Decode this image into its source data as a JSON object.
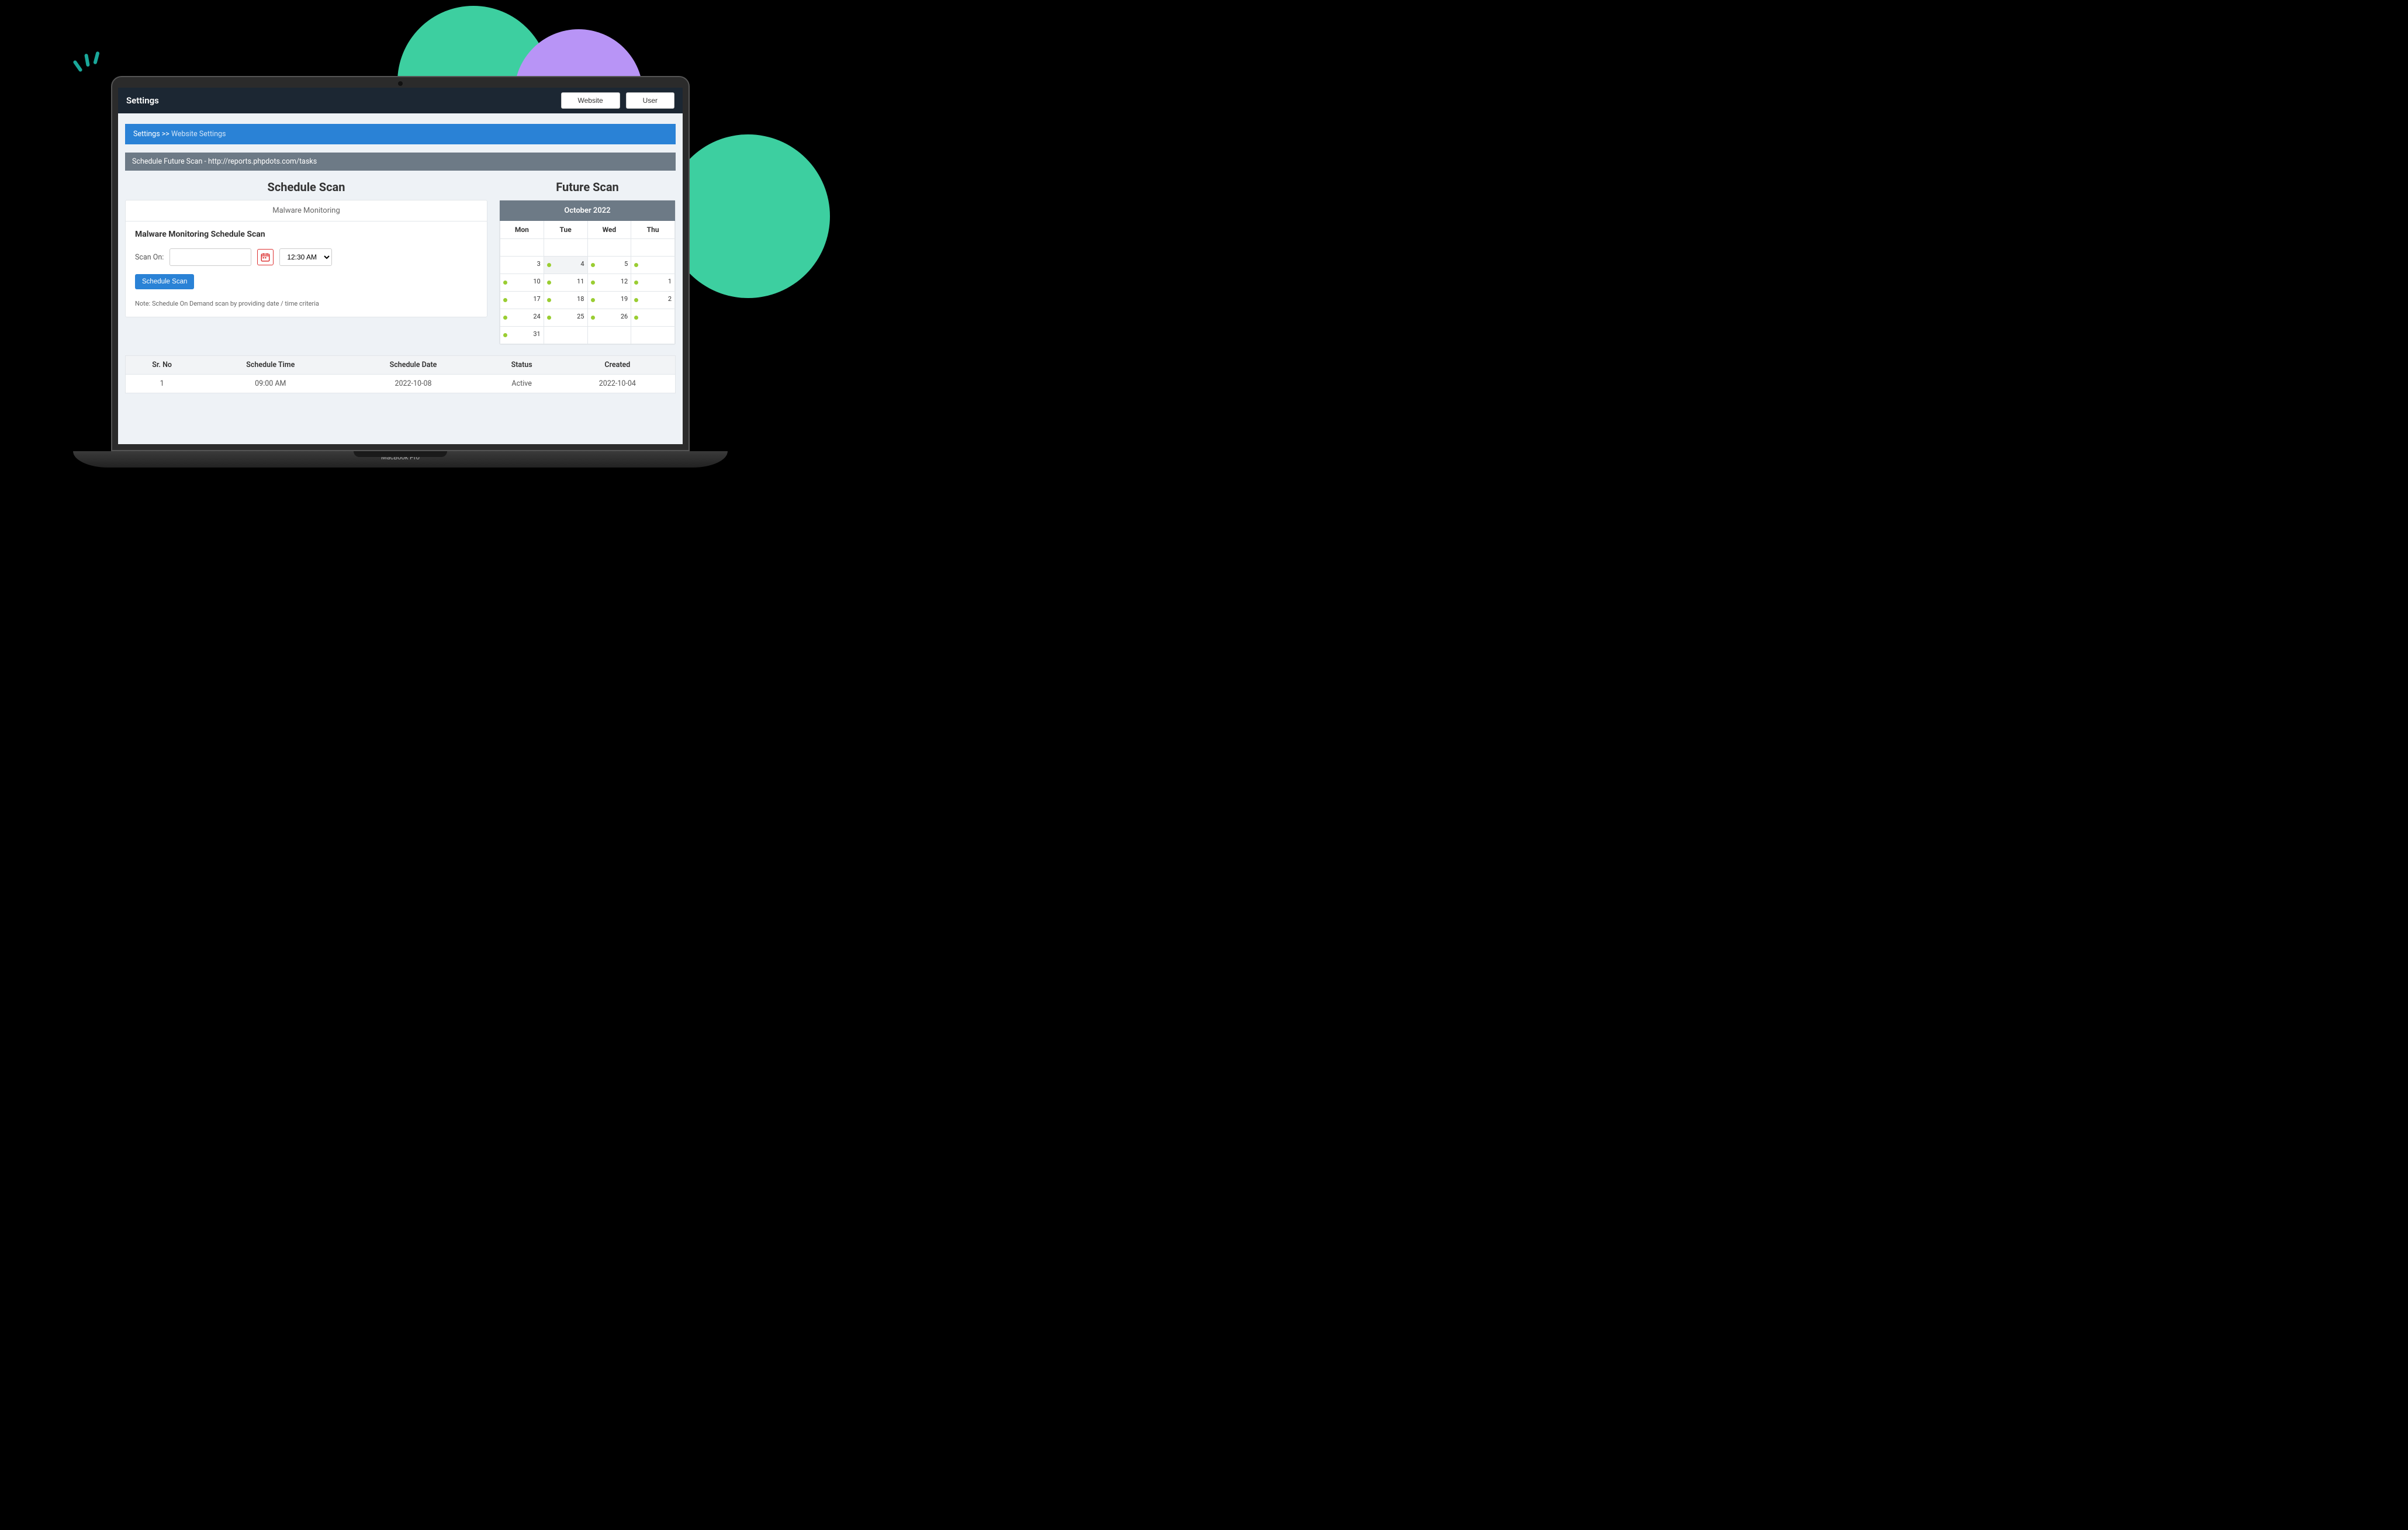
{
  "header": {
    "title": "Settings",
    "buttons": {
      "website": "Website",
      "user": "User"
    }
  },
  "breadcrumb": {
    "root": "Settings",
    "sep": ">>",
    "current": "Website Settings"
  },
  "panel": {
    "title": "Schedule Future Scan - http://reports.phpdots.com/tasks"
  },
  "schedule": {
    "title": "Schedule Scan",
    "tab": "Malware Monitoring",
    "subtitle": "Malware Monitoring Schedule Scan",
    "scan_on_label": "Scan On:",
    "time_value": "12:30 AM",
    "button": "Schedule Scan",
    "note": "Note: Schedule On Demand scan by providing date / time criteria"
  },
  "future": {
    "title": "Future Scan",
    "month": "October 2022",
    "days": [
      "Mon",
      "Tue",
      "Wed",
      "Thu"
    ],
    "weeks": [
      [
        {
          "n": "",
          "dot": false
        },
        {
          "n": "",
          "dot": false
        },
        {
          "n": "",
          "dot": false
        },
        {
          "n": "",
          "dot": false
        }
      ],
      [
        {
          "n": "3",
          "dot": false,
          "rdot": true
        },
        {
          "n": "4",
          "dot": false,
          "hl": true,
          "rdot": true
        },
        {
          "n": "5",
          "dot": false,
          "rdot": true
        },
        {
          "n": "",
          "dot": false
        }
      ],
      [
        {
          "n": "10",
          "dot": true,
          "rdot": true
        },
        {
          "n": "11",
          "dot": false,
          "rdot": true
        },
        {
          "n": "12",
          "dot": false,
          "rdot": true
        },
        {
          "n": "1",
          "dot": false
        }
      ],
      [
        {
          "n": "17",
          "dot": true,
          "rdot": true
        },
        {
          "n": "18",
          "dot": false,
          "rdot": true
        },
        {
          "n": "19",
          "dot": false,
          "rdot": true
        },
        {
          "n": "2",
          "dot": false
        }
      ],
      [
        {
          "n": "24",
          "dot": true,
          "rdot": true
        },
        {
          "n": "25",
          "dot": false,
          "rdot": true
        },
        {
          "n": "26",
          "dot": false,
          "rdot": true
        },
        {
          "n": "",
          "dot": false
        }
      ],
      [
        {
          "n": "31",
          "dot": true
        },
        {
          "n": "",
          "dot": false
        },
        {
          "n": "",
          "dot": false
        },
        {
          "n": "",
          "dot": false
        }
      ]
    ]
  },
  "table": {
    "headers": [
      "Sr. No",
      "Schedule Time",
      "Schedule Date",
      "Status",
      "Created"
    ],
    "rows": [
      {
        "sr": "1",
        "time": "09:00 AM",
        "date": "2022-10-08",
        "status": "Active",
        "created": "2022-10-04"
      }
    ]
  },
  "laptop_model": "MacBook Pro"
}
